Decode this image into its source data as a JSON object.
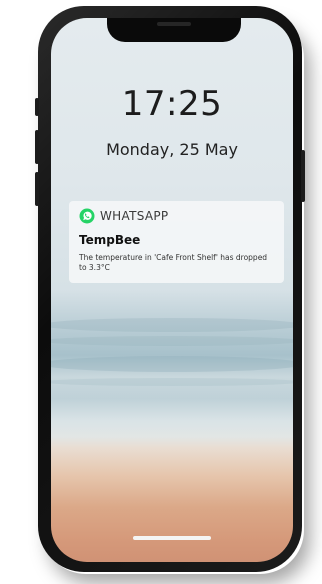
{
  "lock_screen": {
    "time": "17:25",
    "date": "Monday, 25 May"
  },
  "notification": {
    "app_name": "WHATSAPP",
    "app_icon": "whatsapp-icon",
    "title": "TempBee",
    "body": "The temperature in 'Cafe Front Shelf' has dropped to 3.3°C"
  },
  "colors": {
    "whatsapp_green": "#25D366",
    "clock_text": "#1c1c1c",
    "phone_frame": "#111111"
  }
}
